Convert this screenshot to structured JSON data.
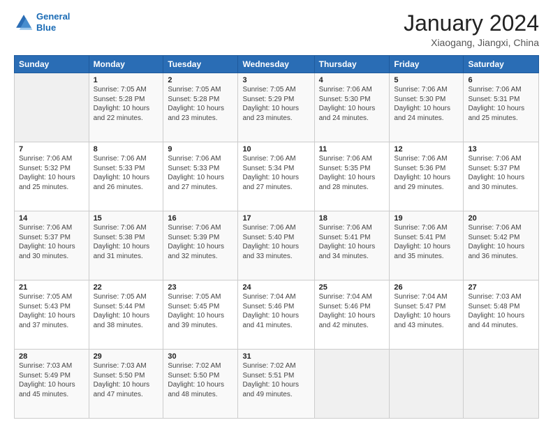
{
  "logo": {
    "line1": "General",
    "line2": "Blue"
  },
  "title": "January 2024",
  "subtitle": "Xiaogang, Jiangxi, China",
  "days_of_week": [
    "Sunday",
    "Monday",
    "Tuesday",
    "Wednesday",
    "Thursday",
    "Friday",
    "Saturday"
  ],
  "weeks": [
    [
      {
        "day": "",
        "sunrise": "",
        "sunset": "",
        "daylight": ""
      },
      {
        "day": "1",
        "sunrise": "Sunrise: 7:05 AM",
        "sunset": "Sunset: 5:28 PM",
        "daylight": "Daylight: 10 hours and 22 minutes."
      },
      {
        "day": "2",
        "sunrise": "Sunrise: 7:05 AM",
        "sunset": "Sunset: 5:28 PM",
        "daylight": "Daylight: 10 hours and 23 minutes."
      },
      {
        "day": "3",
        "sunrise": "Sunrise: 7:05 AM",
        "sunset": "Sunset: 5:29 PM",
        "daylight": "Daylight: 10 hours and 23 minutes."
      },
      {
        "day": "4",
        "sunrise": "Sunrise: 7:06 AM",
        "sunset": "Sunset: 5:30 PM",
        "daylight": "Daylight: 10 hours and 24 minutes."
      },
      {
        "day": "5",
        "sunrise": "Sunrise: 7:06 AM",
        "sunset": "Sunset: 5:30 PM",
        "daylight": "Daylight: 10 hours and 24 minutes."
      },
      {
        "day": "6",
        "sunrise": "Sunrise: 7:06 AM",
        "sunset": "Sunset: 5:31 PM",
        "daylight": "Daylight: 10 hours and 25 minutes."
      }
    ],
    [
      {
        "day": "7",
        "sunrise": "Sunrise: 7:06 AM",
        "sunset": "Sunset: 5:32 PM",
        "daylight": "Daylight: 10 hours and 25 minutes."
      },
      {
        "day": "8",
        "sunrise": "Sunrise: 7:06 AM",
        "sunset": "Sunset: 5:33 PM",
        "daylight": "Daylight: 10 hours and 26 minutes."
      },
      {
        "day": "9",
        "sunrise": "Sunrise: 7:06 AM",
        "sunset": "Sunset: 5:33 PM",
        "daylight": "Daylight: 10 hours and 27 minutes."
      },
      {
        "day": "10",
        "sunrise": "Sunrise: 7:06 AM",
        "sunset": "Sunset: 5:34 PM",
        "daylight": "Daylight: 10 hours and 27 minutes."
      },
      {
        "day": "11",
        "sunrise": "Sunrise: 7:06 AM",
        "sunset": "Sunset: 5:35 PM",
        "daylight": "Daylight: 10 hours and 28 minutes."
      },
      {
        "day": "12",
        "sunrise": "Sunrise: 7:06 AM",
        "sunset": "Sunset: 5:36 PM",
        "daylight": "Daylight: 10 hours and 29 minutes."
      },
      {
        "day": "13",
        "sunrise": "Sunrise: 7:06 AM",
        "sunset": "Sunset: 5:37 PM",
        "daylight": "Daylight: 10 hours and 30 minutes."
      }
    ],
    [
      {
        "day": "14",
        "sunrise": "Sunrise: 7:06 AM",
        "sunset": "Sunset: 5:37 PM",
        "daylight": "Daylight: 10 hours and 30 minutes."
      },
      {
        "day": "15",
        "sunrise": "Sunrise: 7:06 AM",
        "sunset": "Sunset: 5:38 PM",
        "daylight": "Daylight: 10 hours and 31 minutes."
      },
      {
        "day": "16",
        "sunrise": "Sunrise: 7:06 AM",
        "sunset": "Sunset: 5:39 PM",
        "daylight": "Daylight: 10 hours and 32 minutes."
      },
      {
        "day": "17",
        "sunrise": "Sunrise: 7:06 AM",
        "sunset": "Sunset: 5:40 PM",
        "daylight": "Daylight: 10 hours and 33 minutes."
      },
      {
        "day": "18",
        "sunrise": "Sunrise: 7:06 AM",
        "sunset": "Sunset: 5:41 PM",
        "daylight": "Daylight: 10 hours and 34 minutes."
      },
      {
        "day": "19",
        "sunrise": "Sunrise: 7:06 AM",
        "sunset": "Sunset: 5:41 PM",
        "daylight": "Daylight: 10 hours and 35 minutes."
      },
      {
        "day": "20",
        "sunrise": "Sunrise: 7:06 AM",
        "sunset": "Sunset: 5:42 PM",
        "daylight": "Daylight: 10 hours and 36 minutes."
      }
    ],
    [
      {
        "day": "21",
        "sunrise": "Sunrise: 7:05 AM",
        "sunset": "Sunset: 5:43 PM",
        "daylight": "Daylight: 10 hours and 37 minutes."
      },
      {
        "day": "22",
        "sunrise": "Sunrise: 7:05 AM",
        "sunset": "Sunset: 5:44 PM",
        "daylight": "Daylight: 10 hours and 38 minutes."
      },
      {
        "day": "23",
        "sunrise": "Sunrise: 7:05 AM",
        "sunset": "Sunset: 5:45 PM",
        "daylight": "Daylight: 10 hours and 39 minutes."
      },
      {
        "day": "24",
        "sunrise": "Sunrise: 7:04 AM",
        "sunset": "Sunset: 5:46 PM",
        "daylight": "Daylight: 10 hours and 41 minutes."
      },
      {
        "day": "25",
        "sunrise": "Sunrise: 7:04 AM",
        "sunset": "Sunset: 5:46 PM",
        "daylight": "Daylight: 10 hours and 42 minutes."
      },
      {
        "day": "26",
        "sunrise": "Sunrise: 7:04 AM",
        "sunset": "Sunset: 5:47 PM",
        "daylight": "Daylight: 10 hours and 43 minutes."
      },
      {
        "day": "27",
        "sunrise": "Sunrise: 7:03 AM",
        "sunset": "Sunset: 5:48 PM",
        "daylight": "Daylight: 10 hours and 44 minutes."
      }
    ],
    [
      {
        "day": "28",
        "sunrise": "Sunrise: 7:03 AM",
        "sunset": "Sunset: 5:49 PM",
        "daylight": "Daylight: 10 hours and 45 minutes."
      },
      {
        "day": "29",
        "sunrise": "Sunrise: 7:03 AM",
        "sunset": "Sunset: 5:50 PM",
        "daylight": "Daylight: 10 hours and 47 minutes."
      },
      {
        "day": "30",
        "sunrise": "Sunrise: 7:02 AM",
        "sunset": "Sunset: 5:50 PM",
        "daylight": "Daylight: 10 hours and 48 minutes."
      },
      {
        "day": "31",
        "sunrise": "Sunrise: 7:02 AM",
        "sunset": "Sunset: 5:51 PM",
        "daylight": "Daylight: 10 hours and 49 minutes."
      },
      {
        "day": "",
        "sunrise": "",
        "sunset": "",
        "daylight": ""
      },
      {
        "day": "",
        "sunrise": "",
        "sunset": "",
        "daylight": ""
      },
      {
        "day": "",
        "sunrise": "",
        "sunset": "",
        "daylight": ""
      }
    ]
  ]
}
